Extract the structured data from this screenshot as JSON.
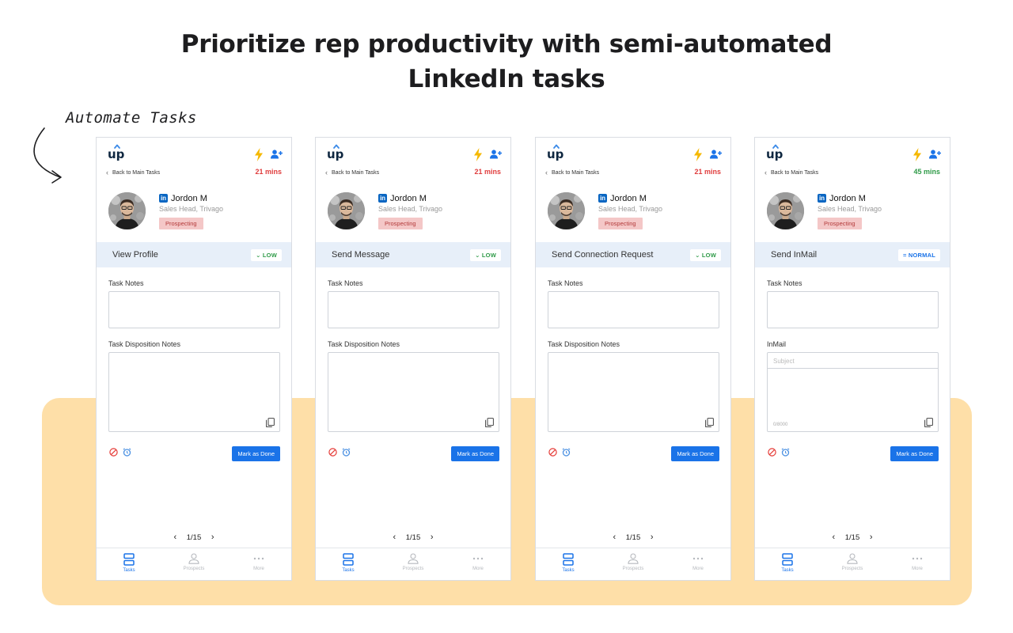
{
  "headline": {
    "line1": "Prioritize rep productivity with semi-automated",
    "line2": "LinkedIn tasks"
  },
  "annotation": {
    "text": "Automate Tasks"
  },
  "colors": {
    "accent": "#1a73e8",
    "timer_red": "#e03e3e",
    "timer_green": "#2e9a47",
    "highlight_band": "#fedfa8",
    "task_bar": "#e7eff9"
  },
  "icons": {
    "logo": "up-logo",
    "bolt": "lightning-bolt-icon",
    "add_user": "add-user-icon",
    "linkedin": "linkedin-icon",
    "copy": "copy-icon",
    "skip": "skip-icon",
    "snooze": "alarm-clock-icon",
    "tasks": "tasks-icon",
    "prospects": "person-icon",
    "more": "ellipsis-icon"
  },
  "phones": [
    {
      "logo_text": "up",
      "back_label": "Back to Main Tasks",
      "timer": "21 mins",
      "timer_color": "red",
      "prospect": {
        "linkedin": "in",
        "name": "Jordon M",
        "title": "Sales Head, Trivago",
        "stage": "Prospecting"
      },
      "task": "View Profile",
      "priority": "LOW",
      "priority_symbol": "⌄",
      "notes_label": "Task Notes",
      "second_label": "Task Disposition Notes",
      "done_label": "Mark as Done",
      "pager": "1/15",
      "tabs": [
        "Tasks",
        "Prospects",
        "More"
      ]
    },
    {
      "logo_text": "up",
      "back_label": "Back to Main Tasks",
      "timer": "21 mins",
      "timer_color": "red",
      "prospect": {
        "linkedin": "in",
        "name": "Jordon M",
        "title": "Sales Head, Trivago",
        "stage": "Prospecting"
      },
      "task": "Send Message",
      "priority": "LOW",
      "priority_symbol": "⌄",
      "notes_label": "Task Notes",
      "second_label": "Task Disposition Notes",
      "done_label": "Mark as Done",
      "pager": "1/15",
      "tabs": [
        "Tasks",
        "Prospects",
        "More"
      ]
    },
    {
      "logo_text": "up",
      "back_label": "Back to Main Tasks",
      "timer": "21 mins",
      "timer_color": "red",
      "prospect": {
        "linkedin": "in",
        "name": "Jordon M",
        "title": "Sales Head, Trivago",
        "stage": "Prospecting"
      },
      "task": "Send Connection Request",
      "priority": "LOW",
      "priority_symbol": "⌄",
      "notes_label": "Task Notes",
      "second_label": "Task Disposition Notes",
      "done_label": "Mark as Done",
      "pager": "1/15",
      "tabs": [
        "Tasks",
        "Prospects",
        "More"
      ]
    },
    {
      "logo_text": "up",
      "back_label": "Back to Main Tasks",
      "timer": "45 mins",
      "timer_color": "green",
      "prospect": {
        "linkedin": "in",
        "name": "Jordon M",
        "title": "Sales Head, Trivago",
        "stage": "Prospecting"
      },
      "task": "Send InMail",
      "priority": "NORMAL",
      "priority_symbol": "=",
      "notes_label": "Task Notes",
      "second_label": "InMail",
      "subject_placeholder": "Subject",
      "char_counter": "0/8000",
      "done_label": "Mark as Done",
      "pager": "1/15",
      "tabs": [
        "Tasks",
        "Prospects",
        "More"
      ]
    }
  ]
}
